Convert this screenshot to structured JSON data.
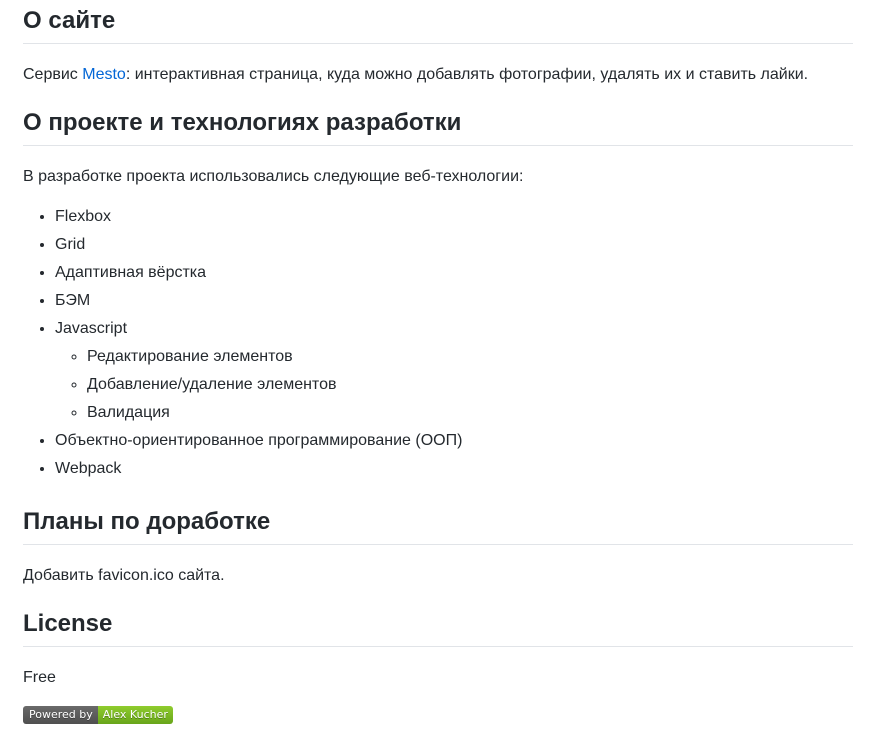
{
  "about": {
    "heading": "О сайте",
    "text_before_link": "Сервис ",
    "link_text": "Mesto",
    "text_after_link": ": интерактивная страница, куда можно добавлять фотографии, удалять их и ставить лайки."
  },
  "tech": {
    "heading": "О проекте и технологиях разработки",
    "intro": "В разработке проекта использовались следующие веб-технологии:",
    "items": [
      "Flexbox",
      "Grid",
      "Адаптивная вёрстка",
      "БЭМ",
      "Javascript",
      "Объектно-ориентированное программирование (ООП)",
      "Webpack"
    ],
    "javascript_subitems": [
      "Редактирование элементов",
      "Добавление/удаление элементов",
      "Валидация"
    ]
  },
  "plans": {
    "heading": "Планы по доработке",
    "text": "Добавить favicon.ico сайта."
  },
  "license": {
    "heading": "License",
    "text": "Free"
  },
  "badge": {
    "left": "Powered by",
    "right": "Alex Kucher",
    "left_color": "#555555",
    "right_color": "#7cb821"
  },
  "colors": {
    "text": "#24292e",
    "link": "#0366d6",
    "divider": "#e1e4e8"
  }
}
